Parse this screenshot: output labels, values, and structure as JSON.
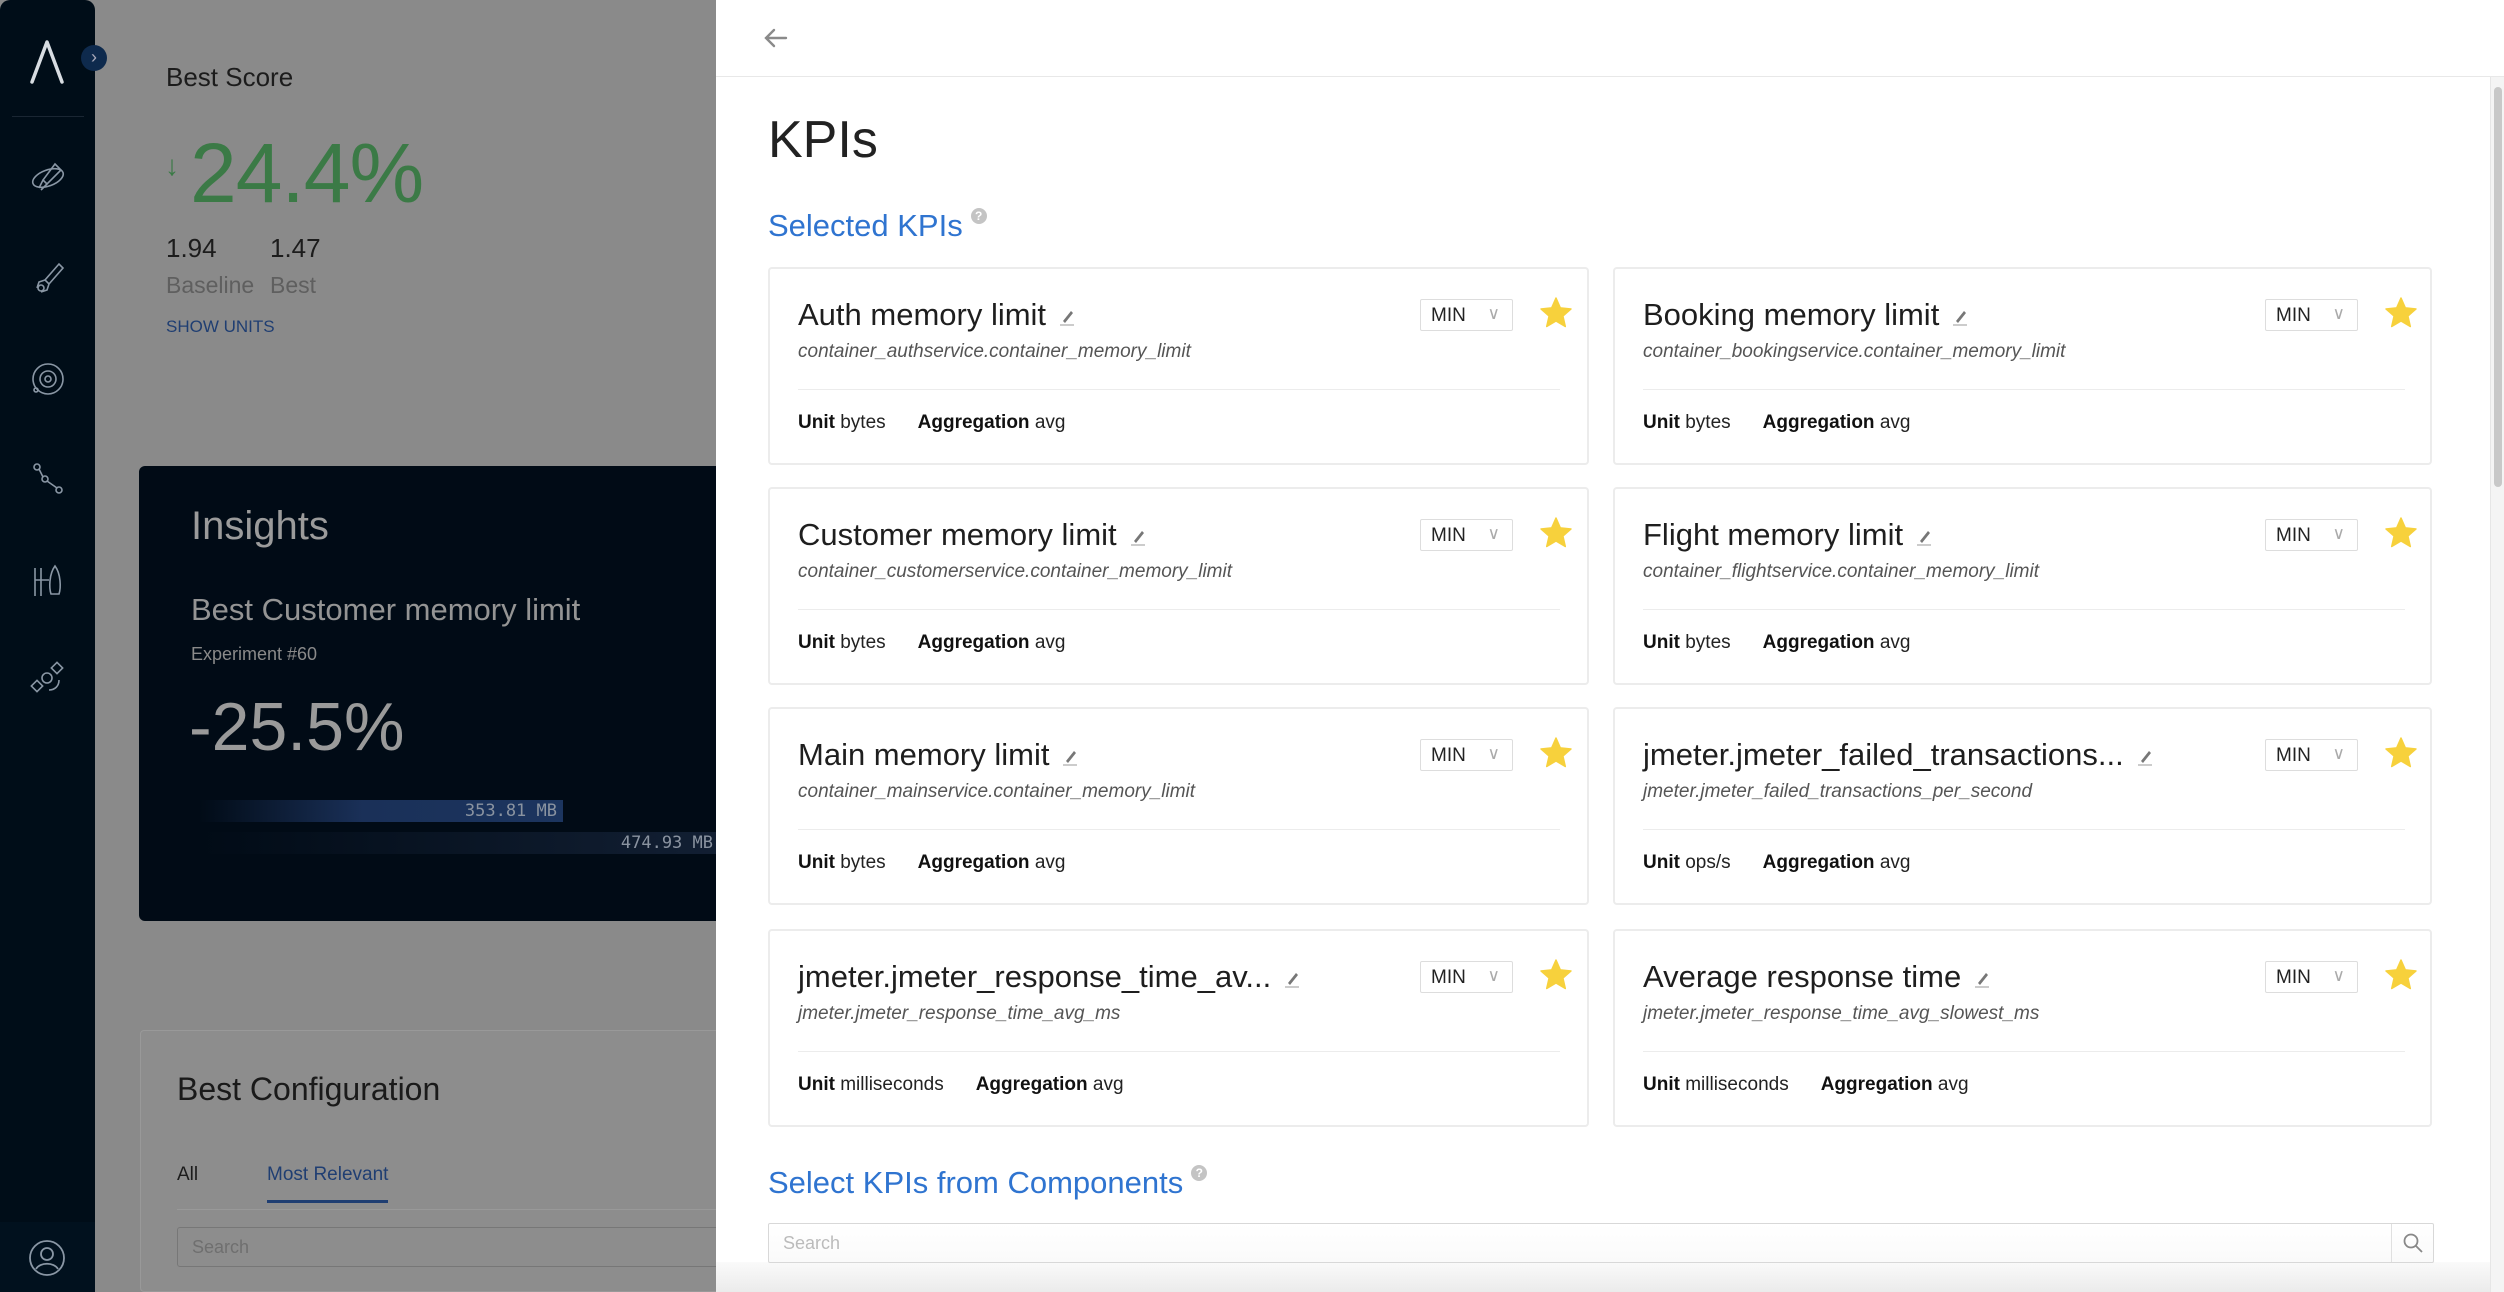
{
  "sidebar": {
    "items": [
      {
        "icon": "rocket-planet-icon"
      },
      {
        "icon": "rocket-icon"
      },
      {
        "icon": "orbit-icon"
      },
      {
        "icon": "workflow-icon"
      },
      {
        "icon": "launchpad-icon"
      },
      {
        "icon": "satellite-icon"
      }
    ],
    "expand_label": "›"
  },
  "background": {
    "best_score": {
      "title": "Best Score",
      "arrow": "↓",
      "value": "24.4%",
      "baseline_value": "1.94",
      "baseline_label": "Baseline",
      "best_value": "1.47",
      "best_label": "Best",
      "show_units": "SHOW UNITS"
    },
    "insights": {
      "title": "Insights",
      "subtitle": "Best Customer memory limit",
      "experiment": "Experiment #60",
      "value": "-25.5%",
      "bars": [
        {
          "label": "353.81 MB",
          "value": 353.81
        },
        {
          "label": "474.93 MB",
          "value": 474.93
        }
      ]
    },
    "best_configuration": {
      "title": "Best Configuration",
      "tabs": [
        "All",
        "Most Relevant"
      ],
      "active_tab": "Most Relevant",
      "search_placeholder": "Search"
    }
  },
  "panel": {
    "title": "KPIs",
    "selected_title": "Selected KPIs",
    "help": "?",
    "components_title": "Select KPIs from Components",
    "components_search_placeholder": "Search",
    "unit_label": "Unit",
    "aggregation_label": "Aggregation",
    "kpis": [
      {
        "name": "Auth memory limit",
        "metric": "container_authservice.container_memory_limit",
        "unit": "bytes",
        "aggregation": "avg",
        "direction": "MIN",
        "starred": true
      },
      {
        "name": "Booking memory limit",
        "metric": "container_bookingservice.container_memory_limit",
        "unit": "bytes",
        "aggregation": "avg",
        "direction": "MIN",
        "starred": true
      },
      {
        "name": "Customer memory limit",
        "metric": "container_customerservice.container_memory_limit",
        "unit": "bytes",
        "aggregation": "avg",
        "direction": "MIN",
        "starred": true
      },
      {
        "name": "Flight memory limit",
        "metric": "container_flightservice.container_memory_limit",
        "unit": "bytes",
        "aggregation": "avg",
        "direction": "MIN",
        "starred": true
      },
      {
        "name": "Main memory limit",
        "metric": "container_mainservice.container_memory_limit",
        "unit": "bytes",
        "aggregation": "avg",
        "direction": "MIN",
        "starred": true
      },
      {
        "name": "jmeter.jmeter_failed_transactions...",
        "metric": "jmeter.jmeter_failed_transactions_per_second",
        "unit": "ops/s",
        "aggregation": "avg",
        "direction": "MIN",
        "starred": true
      },
      {
        "name": "jmeter.jmeter_response_time_av...",
        "metric": "jmeter.jmeter_response_time_avg_ms",
        "unit": "milliseconds",
        "aggregation": "avg",
        "direction": "MIN",
        "starred": true
      },
      {
        "name": "Average response time",
        "metric": "jmeter.jmeter_response_time_avg_slowest_ms",
        "unit": "milliseconds",
        "aggregation": "avg",
        "direction": "MIN",
        "starred": true
      }
    ]
  },
  "colors": {
    "accent": "#2f74d0",
    "star": "#f7d13c",
    "score_green": "#3b7a46",
    "sidebar": "#000d18"
  }
}
